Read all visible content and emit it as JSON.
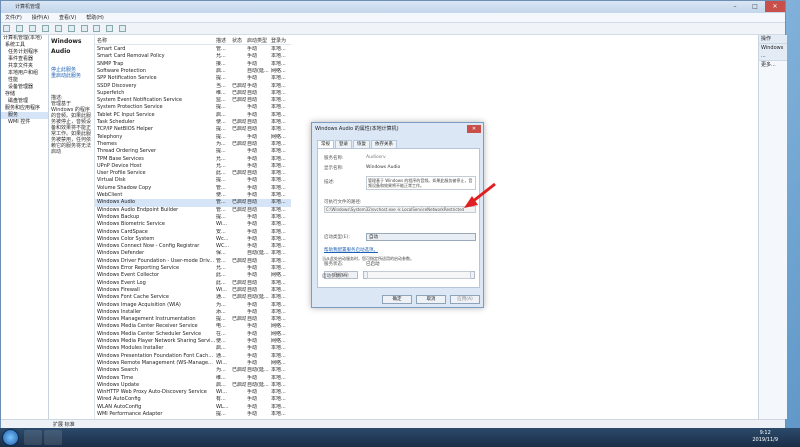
{
  "window": {
    "title": "计算机管理",
    "menu": [
      "文件(F)",
      "操作(A)",
      "查看(V)",
      "帮助(H)"
    ]
  },
  "tree": [
    "计算机管理(本地)",
    "系统工具",
    "任务计划程序",
    "事件查看器",
    "共享文件夹",
    "本地用户和组",
    "性能",
    "设备管理器",
    "存储",
    "磁盘管理",
    "服务和应用程序",
    "服务",
    "WMI 控件"
  ],
  "desc_pane": {
    "title": "Windows Audio",
    "links": [
      "停止此服务",
      "重启动此服务"
    ],
    "desc_label": "描述:",
    "desc_text": [
      "管理基于",
      "Windows 的程序",
      "的音频。如果此服",
      "务被停止，音频设",
      "备和效果将不能正",
      "常工作。如果此服",
      "务被禁用，任何依",
      "赖它的服务将无法",
      "启动"
    ]
  },
  "list": {
    "headers": {
      "name": "名称",
      "desc": "描述",
      "status": "状态",
      "startup": "启动类型",
      "logon": "登录为"
    },
    "rows": [
      [
        "Smart Card",
        "管...",
        "",
        "手动",
        "本地..."
      ],
      [
        "Smart Card Removal Policy",
        "允...",
        "",
        "手动",
        "本地..."
      ],
      [
        "SNMP Trap",
        "接...",
        "",
        "手动",
        "本地..."
      ],
      [
        "Software Protection",
        "启...",
        "",
        "自动(延...",
        "网络..."
      ],
      [
        "SPP Notification Service",
        "提...",
        "",
        "手动",
        "本地..."
      ],
      [
        "SSDP Discovery",
        "当...",
        "已启动",
        "手动",
        "本地..."
      ],
      [
        "Superfetch",
        "维...",
        "已启动",
        "自动",
        "本地..."
      ],
      [
        "System Event Notification Service",
        "监...",
        "已启动",
        "自动",
        "本地..."
      ],
      [
        "System Protection Service",
        "提...",
        "",
        "手动",
        "本地..."
      ],
      [
        "Tablet PC Input Service",
        "启...",
        "",
        "手动",
        "本地..."
      ],
      [
        "Task Scheduler",
        "使...",
        "已启动",
        "自动",
        "本地..."
      ],
      [
        "TCP/IP NetBIOS Helper",
        "提...",
        "已启动",
        "自动",
        "本地..."
      ],
      [
        "Telephony",
        "提...",
        "",
        "手动",
        "网络..."
      ],
      [
        "Themes",
        "为...",
        "已启动",
        "自动",
        "本地..."
      ],
      [
        "Thread Ordering Server",
        "提...",
        "",
        "手动",
        "本地..."
      ],
      [
        "TPM Base Services",
        "允...",
        "",
        "手动",
        "本地..."
      ],
      [
        "UPnP Device Host",
        "允...",
        "",
        "手动",
        "本地..."
      ],
      [
        "User Profile Service",
        "此...",
        "已启动",
        "自动",
        "本地..."
      ],
      [
        "Virtual Disk",
        "提...",
        "",
        "手动",
        "本地..."
      ],
      [
        "Volume Shadow Copy",
        "管...",
        "",
        "手动",
        "本地..."
      ],
      [
        "WebClient",
        "使...",
        "",
        "手动",
        "本地..."
      ],
      [
        "Windows Audio",
        "管...",
        "已启动",
        "自动",
        "本地..."
      ],
      [
        "Windows Audio Endpoint Builder",
        "管...",
        "已启动",
        "自动",
        "本地..."
      ],
      [
        "Windows Backup",
        "提...",
        "",
        "手动",
        "本地..."
      ],
      [
        "Windows Biometric Service",
        "Wi...",
        "",
        "手动",
        "本地..."
      ],
      [
        "Windows CardSpace",
        "安...",
        "",
        "手动",
        "本地..."
      ],
      [
        "Windows Color System",
        "Wc...",
        "",
        "手动",
        "本地..."
      ],
      [
        "Windows Connect Now - Config Registrar",
        "WC...",
        "",
        "手动",
        "本地..."
      ],
      [
        "Windows Defender",
        "保...",
        "",
        "自动(延...",
        "本地..."
      ],
      [
        "Windows Driver Foundation - User-mode Driv...",
        "管...",
        "已启动",
        "自动",
        "本地..."
      ],
      [
        "Windows Error Reporting Service",
        "允...",
        "",
        "手动",
        "本地..."
      ],
      [
        "Windows Event Collector",
        "此...",
        "",
        "手动",
        "网络..."
      ],
      [
        "Windows Event Log",
        "此...",
        "已启动",
        "自动",
        "本地..."
      ],
      [
        "Windows Firewall",
        "Wi...",
        "已启动",
        "自动",
        "本地..."
      ],
      [
        "Windows Font Cache Service",
        "通...",
        "已启动",
        "自动(延...",
        "本地..."
      ],
      [
        "Windows Image Acquisition (WIA)",
        "为...",
        "",
        "手动",
        "本地..."
      ],
      [
        "Windows Installer",
        "添...",
        "",
        "手动",
        "本地..."
      ],
      [
        "Windows Management Instrumentation",
        "提...",
        "已启动",
        "自动",
        "本地..."
      ],
      [
        "Windows Media Center Receiver Service",
        "电...",
        "",
        "手动",
        "网络..."
      ],
      [
        "Windows Media Center Scheduler Service",
        "在...",
        "",
        "手动",
        "网络..."
      ],
      [
        "Windows Media Player Network Sharing Servi...",
        "使...",
        "",
        "手动",
        "网络..."
      ],
      [
        "Windows Modules Installer",
        "启...",
        "",
        "手动",
        "本地..."
      ],
      [
        "Windows Presentation Foundation Font Cach...",
        "通...",
        "",
        "手动",
        "本地..."
      ],
      [
        "Windows Remote Management (WS-Manage...",
        "Wi...",
        "",
        "手动",
        "网络..."
      ],
      [
        "Windows Search",
        "为...",
        "已启动",
        "自动(延...",
        "本地..."
      ],
      [
        "Windows Time",
        "维...",
        "",
        "手动",
        "本地..."
      ],
      [
        "Windows Update",
        "启...",
        "已启动",
        "自动(延...",
        "本地..."
      ],
      [
        "WinHTTP Web Proxy Auto-Discovery Service",
        "Wi...",
        "",
        "手动",
        "本地..."
      ],
      [
        "Wired AutoConfig",
        "有...",
        "",
        "手动",
        "本地..."
      ],
      [
        "WLAN AutoConfig",
        "WL...",
        "",
        "手动",
        "本地..."
      ],
      [
        "WMI Performance Adapter",
        "提...",
        "",
        "手动",
        "本地..."
      ]
    ],
    "selected_index": 21
  },
  "actions": {
    "header1": "操作",
    "header2": "Windows ...",
    "item": "更多..."
  },
  "statusbar": {
    "tabs": "扩展  标准"
  },
  "dialog": {
    "title": "Windows Audio 的属性(本地计算机)",
    "close": "✕",
    "tabs": [
      "常规",
      "登录",
      "恢复",
      "依存关系"
    ],
    "service_name_label": "服务名称:",
    "service_name": "Audiosrv",
    "display_name_label": "显示名称:",
    "display_name": "Windows Audio",
    "desc_label": "描述:",
    "desc": "管理基于 Windows 的程序的音频。如果此服务被停止，音频设备和效果将不能正常工作。",
    "path_label": "可执行文件的路径:",
    "path": "C:\\Windows\\System32\\svchost.exe -k LocalServiceNetworkRestricted",
    "startup_label": "启动类型(E):",
    "startup_value": "自动",
    "help_link": "帮助我配置服务启动选项。",
    "status_label": "服务状态:",
    "status_value": "已启动",
    "btn_start": "启动(S)",
    "btn_stop": "停止(T)",
    "btn_pause": "暂停(P)",
    "btn_resume": "恢复(R)",
    "note": "当从此处启动服务时，您可指定所适用的启动参数。",
    "params_label": "启动参数(M):",
    "ok": "确定",
    "cancel": "取消",
    "apply": "应用(A)"
  },
  "taskbar": {
    "time": "9:12",
    "date": "2019/11/9"
  }
}
